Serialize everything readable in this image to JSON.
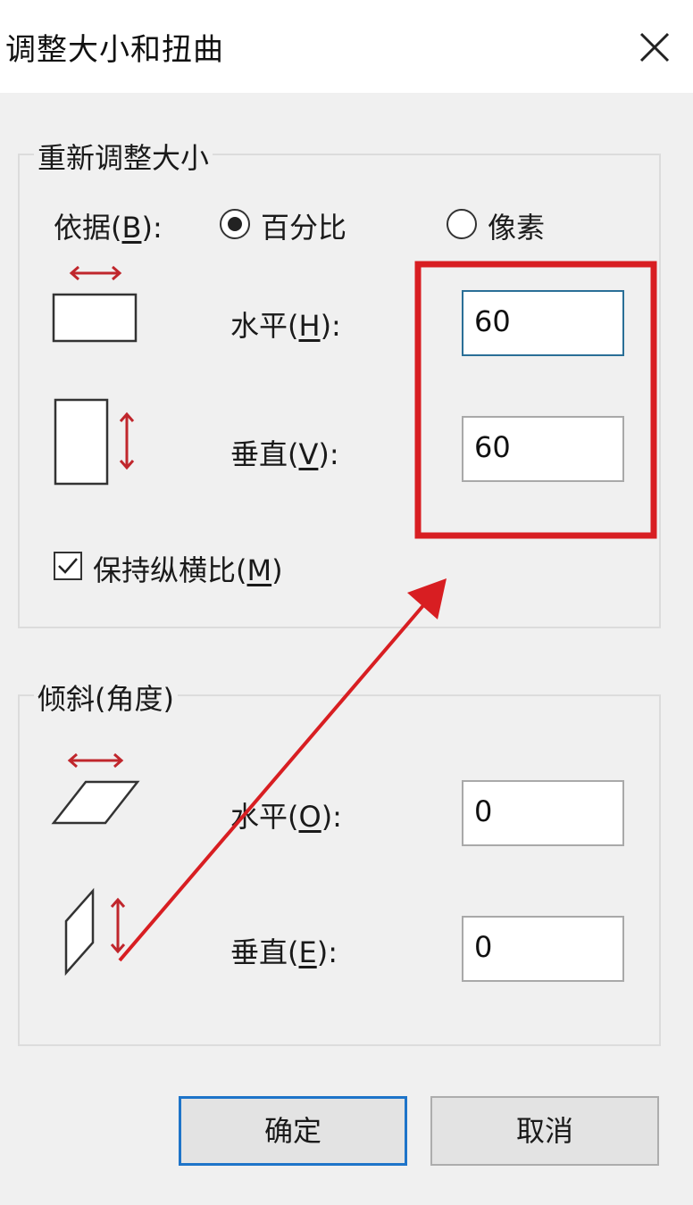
{
  "window": {
    "title": "调整大小和扭曲"
  },
  "resize_group": {
    "legend": "重新调整大小",
    "by_label": "依据(",
    "by_key": "B",
    "by_suffix": "):",
    "option_percent": "百分比",
    "option_pixels": "像素",
    "selected": "percent",
    "horizontal_label": "水平(",
    "horizontal_key": "H",
    "horizontal_suffix": "):",
    "horizontal_value": "60",
    "vertical_label": "垂直(",
    "vertical_key": "V",
    "vertical_suffix": "):",
    "vertical_value": "60",
    "keep_ratio_label": "保持纵横比(",
    "keep_ratio_key": "M",
    "keep_ratio_suffix": ")",
    "keep_ratio_checked": true
  },
  "skew_group": {
    "legend": "倾斜(角度)",
    "horizontal_label": "水平(",
    "horizontal_key": "O",
    "horizontal_suffix": "):",
    "horizontal_value": "0",
    "vertical_label": "垂直(",
    "vertical_key": "E",
    "vertical_suffix": "):",
    "vertical_value": "0"
  },
  "buttons": {
    "ok": "确定",
    "cancel": "取消"
  },
  "colors": {
    "annotation_red": "#d81e22",
    "icon_red": "#c0262c",
    "focus_border": "#2a6f97",
    "default_button_border": "#1e74c9"
  },
  "icons": {
    "close": "close-icon",
    "resize_horizontal": "resize-horizontal-icon",
    "resize_vertical": "resize-vertical-icon",
    "skew_horizontal": "skew-horizontal-icon",
    "skew_vertical": "skew-vertical-icon",
    "check": "checkmark-icon"
  }
}
